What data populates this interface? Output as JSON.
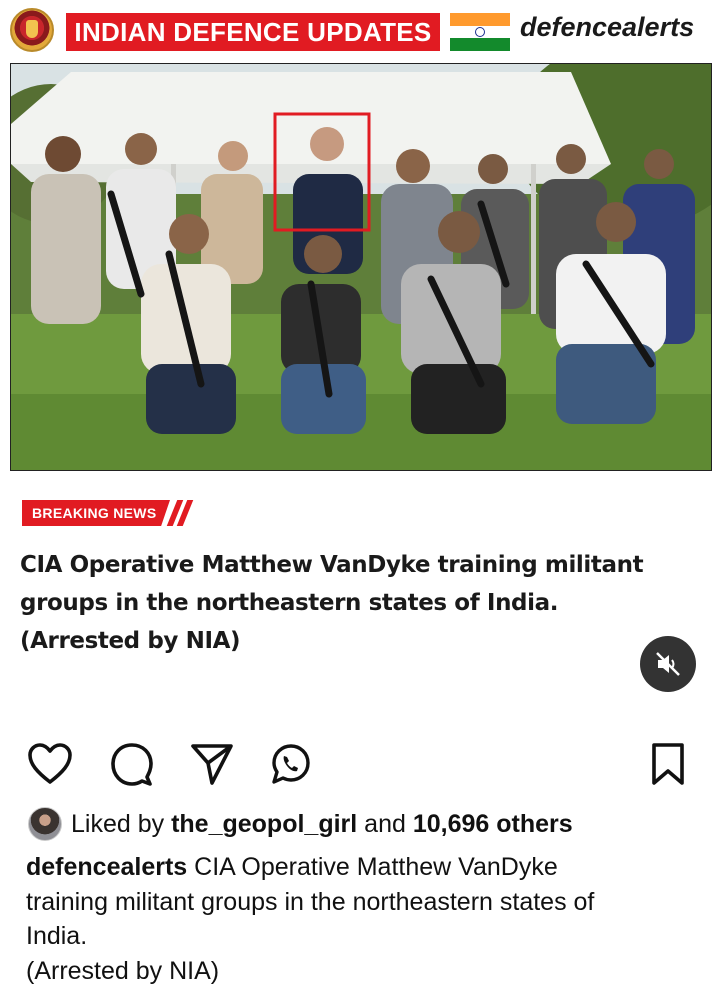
{
  "header": {
    "title": "INDIAN DEFENCE UPDATES",
    "handle": "defencealerts",
    "emblem_icon": "army-emblem-icon",
    "flag_icon": "india-flag-icon"
  },
  "photo": {
    "highlight_color": "#e11b22"
  },
  "breaking_label": "BREAKING NEWS",
  "headline_lines": [
    "CIA Operative Matthew VanDyke training militant",
    "groups in the northeastern states of India.",
    "(Arrested by NIA)"
  ],
  "actions": {
    "like_icon": "heart-icon",
    "comment_icon": "comment-icon",
    "share_icon": "send-icon",
    "whatsapp_icon": "whatsapp-icon",
    "save_icon": "bookmark-icon",
    "mute_icon": "speaker-muted-icon"
  },
  "likes": {
    "prefix": "Liked by",
    "user": "the_geopol_girl",
    "connector": "and",
    "others": "10,696 others"
  },
  "caption": {
    "username": "defencealerts",
    "text_line1": "CIA Operative Matthew VanDyke",
    "text_line2": "training militant groups in the northeastern states of",
    "text_line3": "India.",
    "text_line4": "(Arrested by NIA)"
  },
  "colors": {
    "brand_red": "#e11b22",
    "saffron": "#ff9a2e",
    "green": "#138a2c",
    "mute_bg": "#333333"
  }
}
